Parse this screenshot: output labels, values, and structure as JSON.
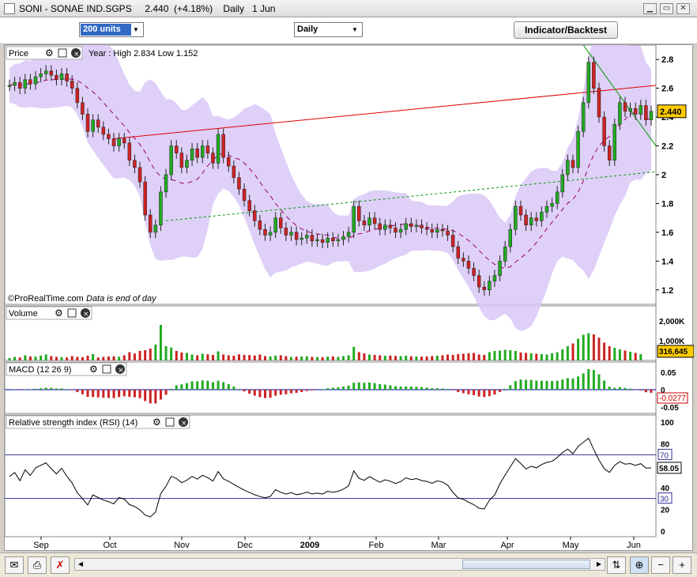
{
  "window": {
    "title": "SONI - SONAE IND.SGPS     2.440  (+4.18%)    Daily   1 Jun"
  },
  "toolbar": {
    "units_value": "200 units",
    "period_value": "Daily",
    "indicator_button": "Indicator/Backtest"
  },
  "price_panel": {
    "label": "Price",
    "year_info": "Year : High 2.834 Low 1.152",
    "watermark": "©ProRealTime.com",
    "note": "Data is end of day",
    "last_price": "2.440",
    "y_ticks": [
      "2.8",
      "2.6",
      "2.4",
      "2.2",
      "2",
      "1.8",
      "1.6",
      "1.4",
      "1.2"
    ]
  },
  "volume_panel": {
    "label": "Volume",
    "y_ticks": [
      "2,000K",
      "1,000K"
    ],
    "last_value": "316,645"
  },
  "macd_panel": {
    "label": "MACD (12 26 9)",
    "y_ticks": [
      "0.05",
      "0",
      "-0.05"
    ],
    "last_value": "-0.0277"
  },
  "rsi_panel": {
    "label": "Relative strength index (RSI) (14)",
    "y_ticks": [
      "100",
      "80",
      "60",
      "40",
      "20",
      "0"
    ],
    "boxed_ticks": [
      "70",
      "30"
    ],
    "last_value": "58.05"
  },
  "x_axis": {
    "labels": [
      "Sep",
      "Oct",
      "Nov",
      "Dec",
      "2009",
      "Feb",
      "Mar",
      "Apr",
      "May",
      "Jun"
    ]
  },
  "colors": {
    "band_fill": "#d9c8f7",
    "up": "#22aa22",
    "down": "#cc2222",
    "ma_line": "#990066",
    "trend_red": "#dd0000",
    "trend_green": "#009900",
    "rsi_line": "#000080",
    "last_price_bg": "#ffcc00"
  },
  "chart_data": {
    "type": "candlestick",
    "price_range": [
      1.1,
      2.9
    ],
    "price_closes": [
      2.62,
      2.64,
      2.6,
      2.66,
      2.63,
      2.68,
      2.7,
      2.72,
      2.69,
      2.66,
      2.7,
      2.65,
      2.6,
      2.5,
      2.42,
      2.3,
      2.38,
      2.33,
      2.28,
      2.25,
      2.2,
      2.25,
      2.22,
      2.1,
      2.05,
      1.95,
      1.72,
      1.6,
      1.65,
      1.88,
      2.0,
      2.2,
      2.15,
      2.05,
      2.1,
      2.18,
      2.12,
      2.2,
      2.15,
      2.08,
      2.28,
      2.12,
      2.06,
      1.98,
      1.9,
      1.82,
      1.75,
      1.68,
      1.62,
      1.58,
      1.6,
      1.7,
      1.63,
      1.58,
      1.6,
      1.55,
      1.56,
      1.58,
      1.54,
      1.55,
      1.53,
      1.56,
      1.54,
      1.55,
      1.57,
      1.6,
      1.78,
      1.68,
      1.65,
      1.7,
      1.66,
      1.62,
      1.65,
      1.63,
      1.6,
      1.62,
      1.66,
      1.64,
      1.65,
      1.63,
      1.62,
      1.6,
      1.62,
      1.61,
      1.58,
      1.5,
      1.42,
      1.4,
      1.35,
      1.3,
      1.22,
      1.2,
      1.26,
      1.3,
      1.4,
      1.5,
      1.62,
      1.78,
      1.72,
      1.65,
      1.7,
      1.68,
      1.74,
      1.78,
      1.8,
      1.88,
      2.0,
      2.1,
      2.05,
      2.3,
      2.5,
      2.78,
      2.6,
      2.4,
      2.2,
      2.1,
      2.35,
      2.5,
      2.44,
      2.46,
      2.42,
      2.48,
      2.38,
      2.44
    ],
    "volume_k": [
      120,
      180,
      150,
      260,
      200,
      190,
      240,
      300,
      220,
      180,
      160,
      150,
      220,
      180,
      170,
      240,
      320,
      150,
      180,
      200,
      210,
      190,
      260,
      420,
      350,
      480,
      520,
      600,
      800,
      1800,
      720,
      650,
      480,
      400,
      380,
      300,
      260,
      340,
      310,
      280,
      460,
      300,
      260,
      240,
      310,
      280,
      270,
      250,
      300,
      220,
      200,
      240,
      260,
      220,
      180,
      190,
      200,
      210,
      180,
      170,
      160,
      190,
      200,
      180,
      220,
      260,
      690,
      420,
      360,
      300,
      280,
      260,
      240,
      250,
      230,
      220,
      240,
      210,
      200,
      190,
      200,
      220,
      240,
      260,
      300,
      280,
      320,
      340,
      360,
      380,
      300,
      280,
      420,
      480,
      500,
      540,
      520,
      480,
      400,
      380,
      360,
      340,
      320,
      300,
      360,
      420,
      560,
      720,
      860,
      1100,
      1300,
      1380,
      1320,
      1150,
      900,
      720,
      640,
      560,
      500,
      440,
      380,
      316
    ],
    "macd_note": "MACD histogram oscillating around zero",
    "rsi_overbought": 70,
    "rsi_oversold": 30,
    "last_rsi": 58.05,
    "last_macd": -0.0277
  }
}
